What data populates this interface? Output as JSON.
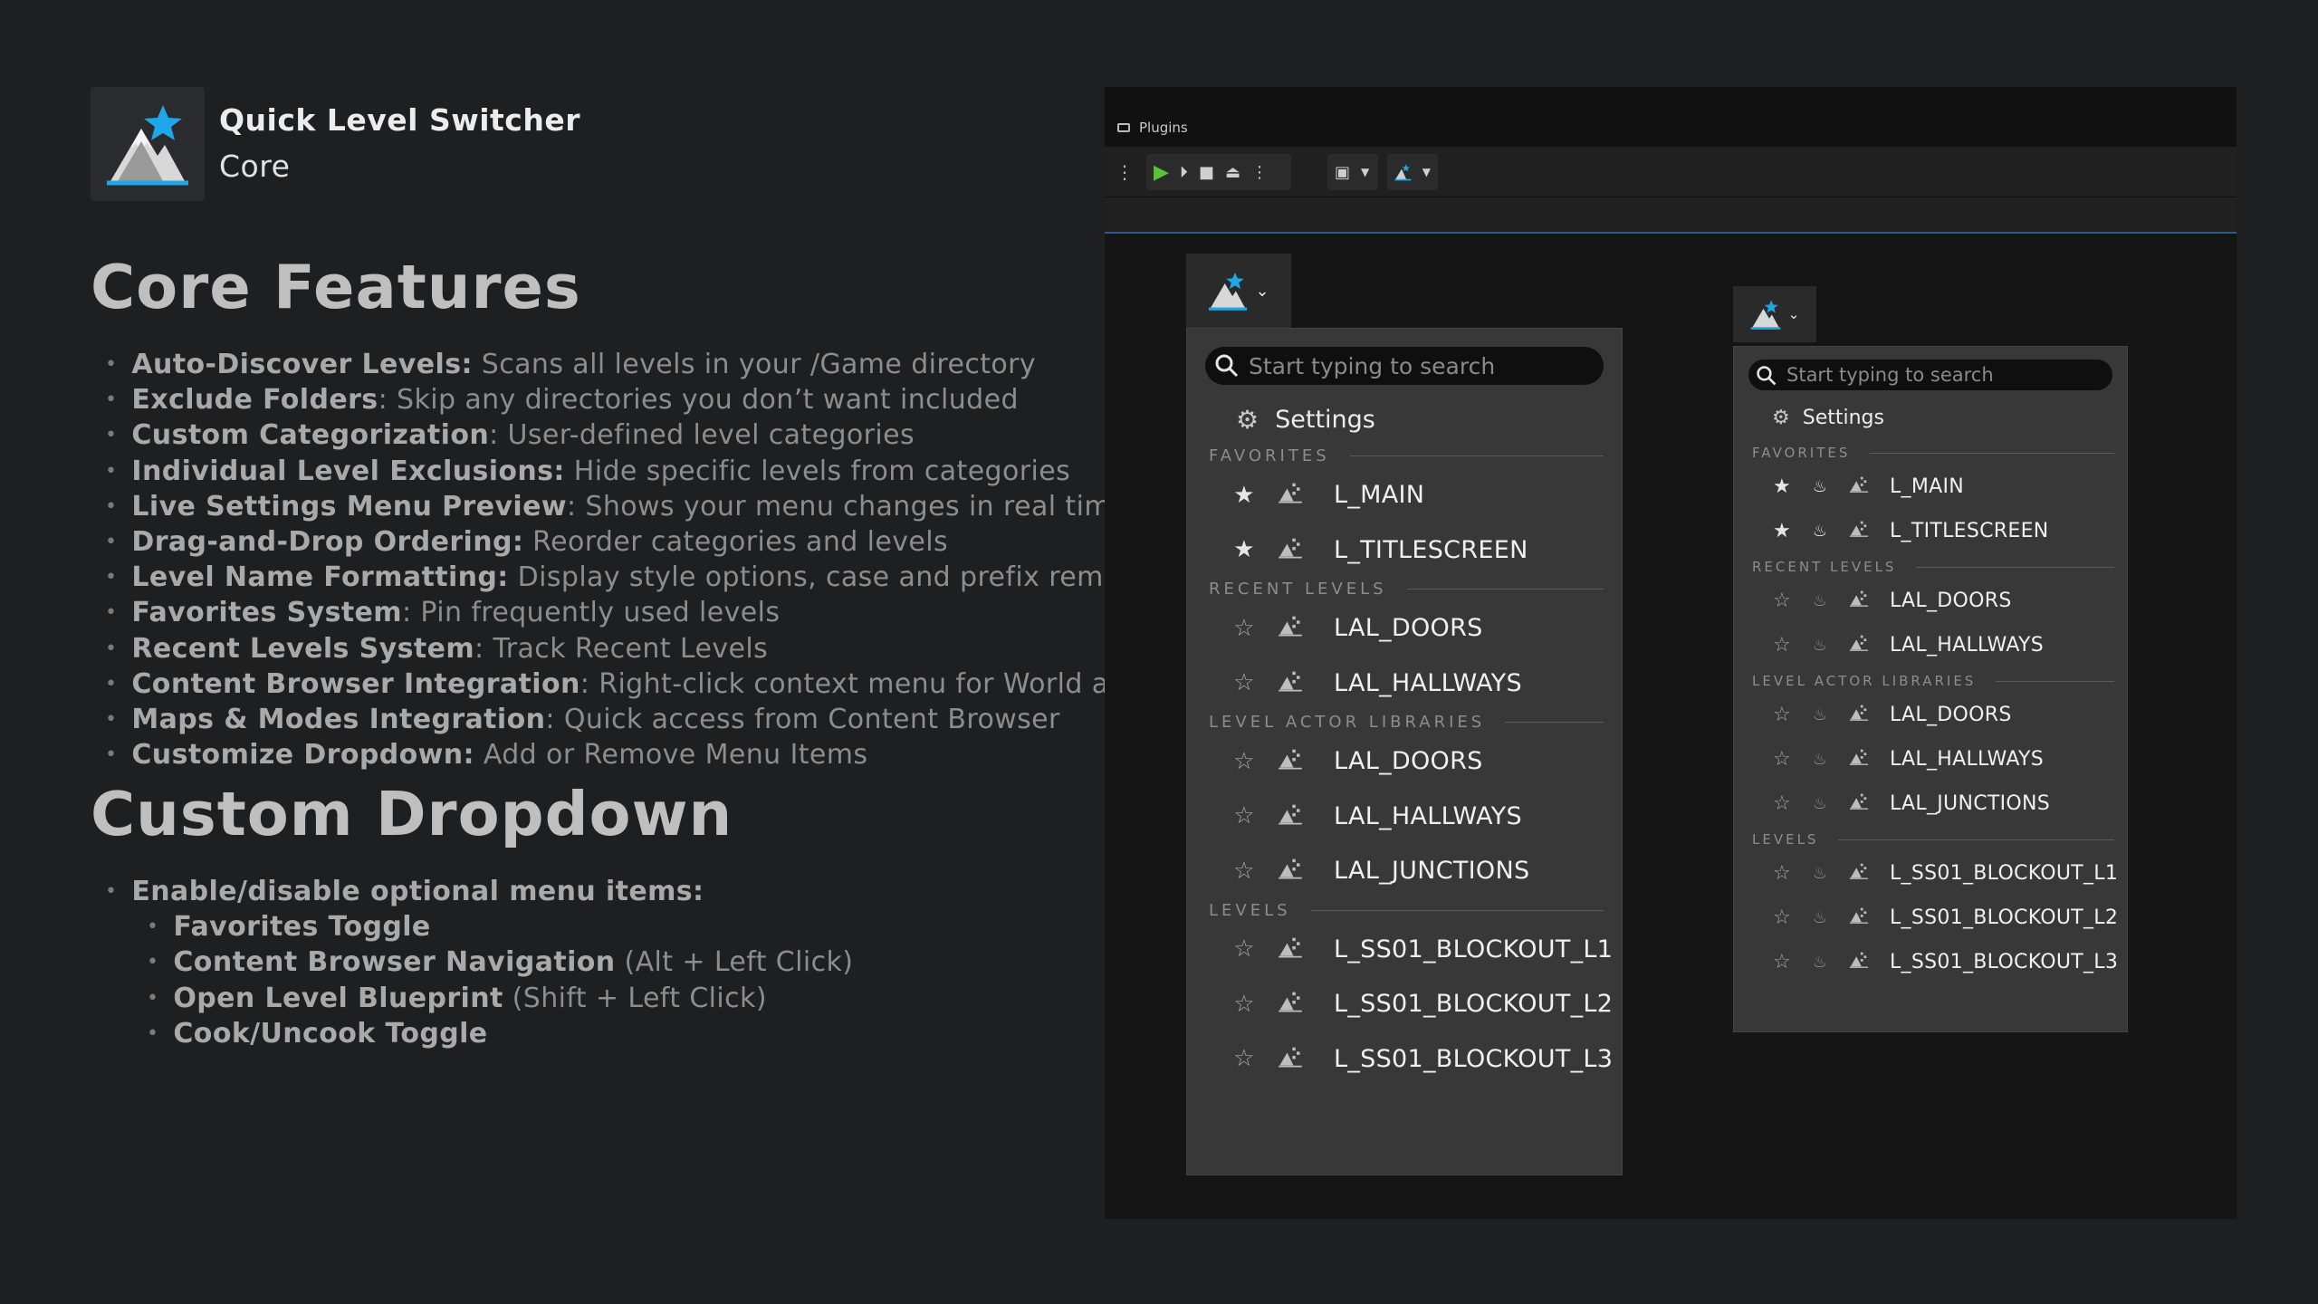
{
  "app": {
    "title": "Quick Level Switcher",
    "subtitle": "Core"
  },
  "core_features": {
    "heading": "Core Features",
    "items": [
      {
        "bold": "Auto-Discover Levels:",
        "rest": " Scans all levels in your /Game directory"
      },
      {
        "bold": "Exclude Folders",
        "rest": ": Skip any directories you don’t want included"
      },
      {
        "bold": "Custom Categorization",
        "rest": ": User-defined level categories"
      },
      {
        "bold": "Individual Level Exclusions:",
        "rest": " Hide specific levels from categories"
      },
      {
        "bold": "Live Settings Menu Preview",
        "rest": ": Shows your menu changes in real time"
      },
      {
        "bold": "Drag-and-Drop Ordering:",
        "rest": "  Reorder categories and levels"
      },
      {
        "bold": "Level Name Formatting:",
        "rest": " Display style options, case and prefix removal."
      },
      {
        "bold": "Favorites System",
        "rest": ": Pin frequently used levels"
      },
      {
        "bold": "Recent Levels System",
        "rest": ": Track Recent Levels"
      },
      {
        "bold": "Content Browser Integration",
        "rest": ": Right-click context menu for World assets"
      },
      {
        "bold": "Maps & Modes Integration",
        "rest": ": Quick access from Content Browser"
      },
      {
        "bold": "Customize Dropdown:",
        "rest": " Add or Remove Menu Items"
      }
    ]
  },
  "custom_dropdown": {
    "heading": "Custom Dropdown",
    "intro": "Enable/disable optional menu items:",
    "items": [
      {
        "bold": "Favorites Toggle",
        "rest": ""
      },
      {
        "bold": "Content Browser Navigation",
        "rest": " (Alt + Left Click)"
      },
      {
        "bold": "Open Level Blueprint",
        "rest": " (Shift + Left Click)"
      },
      {
        "bold": "Cook/Uncook Toggle",
        "rest": ""
      }
    ]
  },
  "editor": {
    "tab_label": "Plugins",
    "colors": {
      "accent_blue": "#1ea7e8",
      "play_green": "#58c23c"
    }
  },
  "menu": {
    "search_placeholder": "Start typing to search",
    "settings_label": "Settings",
    "sections": [
      {
        "label": "FAVORITES",
        "items": [
          {
            "name": "L_MAIN",
            "favorite": true
          },
          {
            "name": "L_TITLESCREEN",
            "favorite": true
          }
        ]
      },
      {
        "label": "RECENT LEVELS",
        "items": [
          {
            "name": "LAL_DOORS",
            "favorite": false
          },
          {
            "name": "LAL_HALLWAYS",
            "favorite": false
          }
        ]
      },
      {
        "label": "LEVEL ACTOR LIBRARIES",
        "items": [
          {
            "name": "LAL_DOORS",
            "favorite": false
          },
          {
            "name": "LAL_HALLWAYS",
            "favorite": false
          },
          {
            "name": "LAL_JUNCTIONS",
            "favorite": false
          }
        ]
      },
      {
        "label": "LEVELS",
        "items": [
          {
            "name": "L_SS01_BLOCKOUT_L1",
            "favorite": false
          },
          {
            "name": "L_SS01_BLOCKOUT_L2",
            "favorite": false
          },
          {
            "name": "L_SS01_BLOCKOUT_L3",
            "favorite": false
          }
        ]
      }
    ]
  }
}
